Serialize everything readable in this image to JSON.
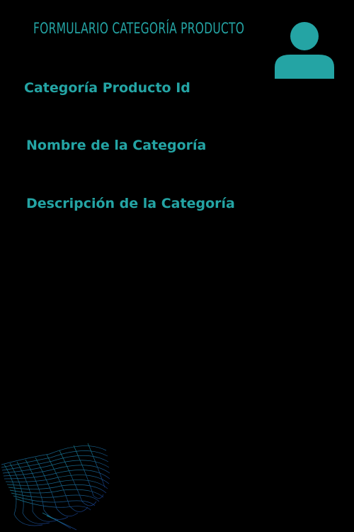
{
  "form": {
    "title": "FORMULARIO CATEGORÍA PRODUCTO",
    "fields": [
      {
        "label": "Categoría Producto Id"
      },
      {
        "label": "Nombre de la Categoría"
      },
      {
        "label": "Descripción de la Categoría"
      }
    ]
  },
  "icons": {
    "avatar": "user-silhouette-icon",
    "decoration": "wave-mesh-graphic"
  },
  "colors": {
    "background": "#000000",
    "accent": "#24a4a4"
  }
}
